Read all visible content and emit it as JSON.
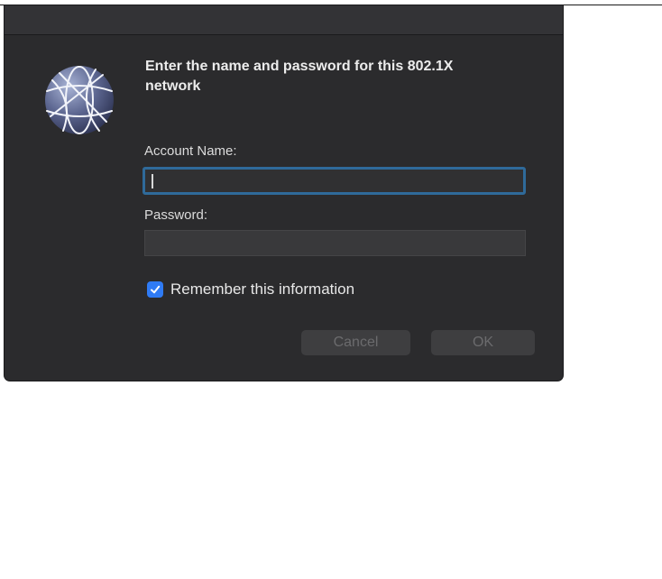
{
  "dialog": {
    "icon": "network-globe-icon",
    "heading": "Enter the name and password for this 802.1X network",
    "account_label": "Account Name:",
    "account_value": "",
    "password_label": "Password:",
    "password_value": "",
    "remember_label": "Remember this information",
    "remember_checked": true,
    "cancel_label": "Cancel",
    "ok_label": "OK"
  },
  "colors": {
    "dialog_bg": "#2b2b2d",
    "focus_ring": "#2f6a9a",
    "checkbox_accent": "#2f7bf5",
    "disabled_button_text": "#6b6b6d"
  }
}
